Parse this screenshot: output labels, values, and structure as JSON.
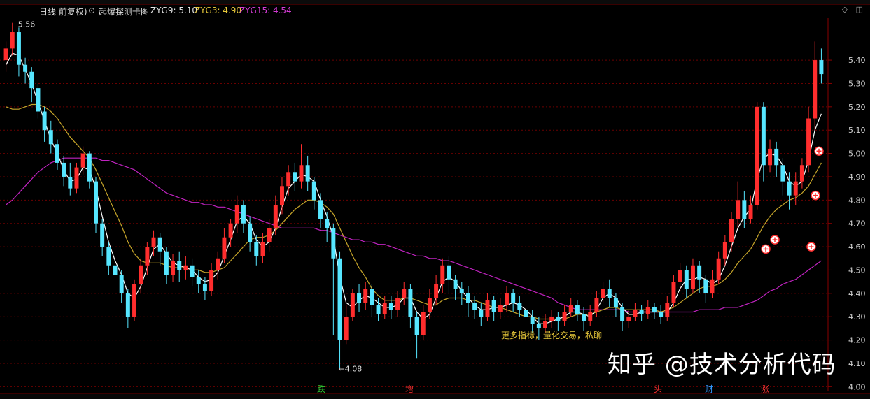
{
  "header": {
    "period": "日线 前复权)",
    "indicator_name": "起爆探测卡图",
    "zyg9_label": "ZYG9: 5.10",
    "zyg3_label": "ZYG3: 4.90",
    "zyg15_label": "ZYG15: 4.54"
  },
  "controls": {
    "diamond": "◇",
    "restore": "◫"
  },
  "colors": {
    "up": "#ff2d2d",
    "down": "#56e6ff",
    "zyg3": "#ffffff",
    "zyg9": "#c6a52a",
    "zyg15": "#c023c0",
    "grid": "#6b0000",
    "axis_text": "#d0d0d0"
  },
  "watermark": "知乎 @技术分析代码",
  "overlay_text": "更多指标，量化交易，私聊",
  "markers": [
    {
      "label": "跌",
      "color": "#33cc33"
    },
    {
      "label": "增",
      "color": "#ff3333"
    },
    {
      "label": "头",
      "color": "#ff3333"
    },
    {
      "label": "财",
      "color": "#3399ff"
    },
    {
      "label": "涨",
      "color": "#ff3333"
    }
  ],
  "chart_data": {
    "type": "candlestick",
    "y_ticks": [
      "5.40",
      "5.30",
      "5.20",
      "5.10",
      "5.00",
      "4.90",
      "4.80",
      "4.70",
      "4.60",
      "4.50",
      "4.40",
      "4.30",
      "4.20",
      "4.10",
      "4.00"
    ],
    "ylim": [
      3.98,
      5.58
    ],
    "high_label": "5.56",
    "low_label": "←4.08",
    "high_price": 5.56,
    "low_price": 4.08,
    "candles": [
      [
        5.4,
        5.45,
        5.35,
        5.48
      ],
      [
        5.45,
        5.52,
        5.42,
        5.56
      ],
      [
        5.52,
        5.38,
        5.33,
        5.54
      ],
      [
        5.38,
        5.35,
        5.3,
        5.41
      ],
      [
        5.35,
        5.28,
        5.22,
        5.37
      ],
      [
        5.28,
        5.18,
        5.15,
        5.3
      ],
      [
        5.18,
        5.1,
        5.05,
        5.2
      ],
      [
        5.1,
        5.04,
        5.0,
        5.14
      ],
      [
        5.04,
        4.96,
        4.93,
        5.06
      ],
      [
        4.96,
        4.9,
        4.86,
        4.99
      ],
      [
        4.9,
        4.85,
        4.82,
        4.96
      ],
      [
        4.85,
        4.94,
        4.83,
        4.96
      ],
      [
        4.94,
        5.0,
        4.91,
        5.03
      ],
      [
        5.0,
        4.88,
        4.85,
        5.01
      ],
      [
        4.88,
        4.7,
        4.66,
        4.9
      ],
      [
        4.7,
        4.6,
        4.56,
        4.72
      ],
      [
        4.6,
        4.52,
        4.48,
        4.62
      ],
      [
        4.52,
        4.48,
        4.44,
        4.55
      ],
      [
        4.48,
        4.4,
        4.36,
        4.5
      ],
      [
        4.4,
        4.3,
        4.25,
        4.42
      ],
      [
        4.3,
        4.44,
        4.28,
        4.46
      ],
      [
        4.44,
        4.52,
        4.4,
        4.55
      ],
      [
        4.52,
        4.6,
        4.48,
        4.62
      ],
      [
        4.6,
        4.64,
        4.56,
        4.67
      ],
      [
        4.64,
        4.58,
        4.52,
        4.66
      ],
      [
        4.58,
        4.48,
        4.44,
        4.6
      ],
      [
        4.48,
        4.54,
        4.45,
        4.57
      ],
      [
        4.54,
        4.5,
        4.45,
        4.58
      ],
      [
        4.5,
        4.52,
        4.46,
        4.56
      ],
      [
        4.52,
        4.47,
        4.43,
        4.55
      ],
      [
        4.47,
        4.44,
        4.4,
        4.5
      ],
      [
        4.44,
        4.41,
        4.37,
        4.47
      ],
      [
        4.41,
        4.5,
        4.39,
        4.53
      ],
      [
        4.5,
        4.55,
        4.46,
        4.58
      ],
      [
        4.55,
        4.64,
        4.53,
        4.68
      ],
      [
        4.64,
        4.7,
        4.6,
        4.72
      ],
      [
        4.7,
        4.78,
        4.66,
        4.82
      ],
      [
        4.78,
        4.7,
        4.66,
        4.8
      ],
      [
        4.7,
        4.62,
        4.58,
        4.73
      ],
      [
        4.62,
        4.56,
        4.52,
        4.65
      ],
      [
        4.56,
        4.62,
        4.53,
        4.66
      ],
      [
        4.62,
        4.68,
        4.58,
        4.72
      ],
      [
        4.68,
        4.78,
        4.65,
        4.82
      ],
      [
        4.78,
        4.86,
        4.74,
        4.9
      ],
      [
        4.86,
        4.92,
        4.82,
        4.95
      ],
      [
        4.92,
        4.88,
        4.84,
        4.96
      ],
      [
        4.88,
        4.95,
        4.85,
        5.04
      ],
      [
        4.95,
        4.88,
        4.84,
        4.99
      ],
      [
        4.88,
        4.8,
        4.76,
        4.9
      ],
      [
        4.8,
        4.72,
        4.68,
        4.83
      ],
      [
        4.72,
        4.68,
        4.62,
        4.75
      ],
      [
        4.68,
        4.55,
        4.22,
        4.7
      ],
      [
        4.55,
        4.2,
        4.08,
        4.58
      ],
      [
        4.2,
        4.3,
        4.18,
        4.35
      ],
      [
        4.3,
        4.4,
        4.28,
        4.42
      ],
      [
        4.4,
        4.36,
        4.32,
        4.44
      ],
      [
        4.36,
        4.42,
        4.33,
        4.45
      ],
      [
        4.42,
        4.35,
        4.3,
        4.44
      ],
      [
        4.35,
        4.31,
        4.28,
        4.38
      ],
      [
        4.31,
        4.36,
        4.29,
        4.39
      ],
      [
        4.36,
        4.33,
        4.29,
        4.39
      ],
      [
        4.33,
        4.38,
        4.3,
        4.41
      ],
      [
        4.38,
        4.42,
        4.35,
        4.45
      ],
      [
        4.42,
        4.3,
        4.25,
        4.44
      ],
      [
        4.3,
        4.22,
        4.12,
        4.32
      ],
      [
        4.22,
        4.32,
        4.2,
        4.35
      ],
      [
        4.32,
        4.38,
        4.29,
        4.42
      ],
      [
        4.38,
        4.44,
        4.35,
        4.48
      ],
      [
        4.44,
        4.52,
        4.4,
        4.55
      ],
      [
        4.52,
        4.46,
        4.4,
        4.56
      ],
      [
        4.46,
        4.42,
        4.37,
        4.48
      ],
      [
        4.42,
        4.4,
        4.35,
        4.45
      ],
      [
        4.4,
        4.36,
        4.3,
        4.43
      ],
      [
        4.36,
        4.33,
        4.29,
        4.39
      ],
      [
        4.33,
        4.3,
        4.26,
        4.36
      ],
      [
        4.3,
        4.37,
        4.28,
        4.4
      ],
      [
        4.37,
        4.32,
        4.28,
        4.39
      ],
      [
        4.32,
        4.35,
        4.29,
        4.38
      ],
      [
        4.35,
        4.4,
        4.32,
        4.43
      ],
      [
        4.4,
        4.36,
        4.32,
        4.42
      ],
      [
        4.36,
        4.33,
        4.3,
        4.39
      ],
      [
        4.33,
        4.3,
        4.26,
        4.36
      ],
      [
        4.3,
        4.27,
        4.23,
        4.33
      ],
      [
        4.27,
        4.25,
        4.2,
        4.3
      ],
      [
        4.25,
        4.28,
        4.23,
        4.31
      ],
      [
        4.28,
        4.3,
        4.25,
        4.33
      ],
      [
        4.3,
        4.28,
        4.24,
        4.32
      ],
      [
        4.28,
        4.32,
        4.26,
        4.35
      ],
      [
        4.32,
        4.35,
        4.3,
        4.38
      ],
      [
        4.35,
        4.31,
        4.28,
        4.37
      ],
      [
        4.31,
        4.28,
        4.24,
        4.34
      ],
      [
        4.28,
        4.32,
        4.26,
        4.35
      ],
      [
        4.32,
        4.38,
        4.3,
        4.41
      ],
      [
        4.38,
        4.42,
        4.36,
        4.45
      ],
      [
        4.42,
        4.38,
        4.34,
        4.46
      ],
      [
        4.38,
        4.34,
        4.3,
        4.4
      ],
      [
        4.34,
        4.28,
        4.24,
        4.36
      ],
      [
        4.28,
        4.3,
        4.25,
        4.33
      ],
      [
        4.3,
        4.33,
        4.28,
        4.36
      ],
      [
        4.33,
        4.31,
        4.28,
        4.35
      ],
      [
        4.31,
        4.34,
        4.29,
        4.37
      ],
      [
        4.34,
        4.32,
        4.29,
        4.36
      ],
      [
        4.32,
        4.3,
        4.27,
        4.35
      ],
      [
        4.3,
        4.36,
        4.28,
        4.39
      ],
      [
        4.36,
        4.45,
        4.34,
        4.48
      ],
      [
        4.45,
        4.5,
        4.41,
        4.53
      ],
      [
        4.5,
        4.42,
        4.38,
        4.52
      ],
      [
        4.42,
        4.52,
        4.4,
        4.55
      ],
      [
        4.52,
        4.46,
        4.4,
        4.54
      ],
      [
        4.46,
        4.4,
        4.36,
        4.48
      ],
      [
        4.4,
        4.46,
        4.38,
        4.5
      ],
      [
        4.46,
        4.55,
        4.44,
        4.58
      ],
      [
        4.55,
        4.62,
        4.52,
        4.65
      ],
      [
        4.62,
        4.72,
        4.58,
        4.75
      ],
      [
        4.72,
        4.8,
        4.68,
        4.88
      ],
      [
        4.8,
        4.72,
        4.68,
        4.84
      ],
      [
        4.72,
        4.78,
        4.7,
        4.82
      ],
      [
        4.78,
        5.2,
        4.76,
        5.22
      ],
      [
        5.2,
        4.95,
        4.88,
        5.22
      ],
      [
        4.95,
        5.02,
        4.92,
        5.06
      ],
      [
        5.02,
        4.95,
        4.9,
        5.05
      ],
      [
        4.95,
        4.88,
        4.82,
        4.98
      ],
      [
        4.88,
        4.82,
        4.76,
        4.92
      ],
      [
        4.82,
        4.88,
        4.78,
        4.92
      ],
      [
        4.88,
        4.95,
        4.85,
        4.98
      ],
      [
        4.95,
        5.15,
        4.92,
        5.2
      ],
      [
        5.15,
        5.4,
        5.1,
        5.48
      ],
      [
        5.4,
        5.34,
        5.3,
        5.45
      ]
    ],
    "zyg3": [
      5.38,
      5.43,
      5.42,
      5.36,
      5.3,
      5.22,
      5.14,
      5.06,
      5.0,
      4.93,
      4.88,
      4.89,
      4.94,
      4.93,
      4.85,
      4.73,
      4.62,
      4.54,
      4.48,
      4.4,
      4.38,
      4.43,
      4.51,
      4.59,
      4.61,
      4.57,
      4.53,
      4.52,
      4.51,
      4.5,
      4.47,
      4.45,
      4.46,
      4.49,
      4.56,
      4.63,
      4.71,
      4.73,
      4.7,
      4.63,
      4.6,
      4.62,
      4.68,
      4.77,
      4.85,
      4.88,
      4.91,
      4.9,
      4.88,
      4.8,
      4.73,
      4.64,
      4.47,
      4.36,
      4.34,
      4.37,
      4.39,
      4.38,
      4.36,
      4.34,
      4.34,
      4.35,
      4.38,
      4.38,
      4.32,
      4.29,
      4.31,
      4.38,
      4.45,
      4.47,
      4.45,
      4.41,
      4.38,
      4.35,
      4.33,
      4.33,
      4.34,
      4.34,
      4.35,
      4.36,
      4.35,
      4.33,
      4.3,
      4.27,
      4.27,
      4.28,
      4.29,
      4.3,
      4.32,
      4.32,
      4.31,
      4.3,
      4.33,
      4.38,
      4.4,
      4.38,
      4.34,
      4.31,
      4.31,
      4.32,
      4.32,
      4.32,
      4.32,
      4.32,
      4.36,
      4.42,
      4.46,
      4.46,
      4.47,
      4.46,
      4.44,
      4.46,
      4.52,
      4.6,
      4.68,
      4.73,
      4.76,
      4.89,
      4.98,
      5.0,
      4.99,
      4.95,
      4.88,
      4.86,
      4.88,
      4.97,
      5.1,
      5.17
    ],
    "zyg9": [
      5.2,
      5.19,
      5.19,
      5.2,
      5.21,
      5.21,
      5.2,
      5.18,
      5.15,
      5.11,
      5.07,
      5.04,
      5.01,
      4.98,
      4.93,
      4.87,
      4.81,
      4.75,
      4.69,
      4.62,
      4.57,
      4.54,
      4.53,
      4.53,
      4.53,
      4.52,
      4.51,
      4.51,
      4.51,
      4.5,
      4.5,
      4.49,
      4.49,
      4.5,
      4.51,
      4.54,
      4.57,
      4.6,
      4.63,
      4.64,
      4.64,
      4.65,
      4.67,
      4.7,
      4.73,
      4.76,
      4.78,
      4.8,
      4.8,
      4.79,
      4.77,
      4.74,
      4.68,
      4.62,
      4.56,
      4.51,
      4.47,
      4.42,
      4.39,
      4.37,
      4.37,
      4.37,
      4.38,
      4.38,
      4.37,
      4.36,
      4.35,
      4.35,
      4.37,
      4.38,
      4.38,
      4.38,
      4.37,
      4.37,
      4.36,
      4.35,
      4.34,
      4.34,
      4.33,
      4.32,
      4.31,
      4.3,
      4.3,
      4.29,
      4.29,
      4.29,
      4.29,
      4.29,
      4.3,
      4.31,
      4.31,
      4.31,
      4.32,
      4.33,
      4.34,
      4.34,
      4.33,
      4.33,
      4.33,
      4.33,
      4.33,
      4.33,
      4.32,
      4.33,
      4.34,
      4.36,
      4.38,
      4.4,
      4.42,
      4.43,
      4.43,
      4.44,
      4.46,
      4.49,
      4.53,
      4.56,
      4.59,
      4.64,
      4.69,
      4.73,
      4.76,
      4.78,
      4.8,
      4.81,
      4.83,
      4.86,
      4.91,
      4.96
    ],
    "zyg15": [
      4.78,
      4.8,
      4.83,
      4.86,
      4.89,
      4.92,
      4.94,
      4.96,
      4.97,
      4.98,
      4.98,
      4.98,
      4.98,
      4.98,
      4.98,
      4.97,
      4.97,
      4.96,
      4.95,
      4.94,
      4.93,
      4.91,
      4.89,
      4.87,
      4.85,
      4.83,
      4.82,
      4.81,
      4.8,
      4.79,
      4.79,
      4.78,
      4.78,
      4.77,
      4.77,
      4.76,
      4.75,
      4.74,
      4.73,
      4.72,
      4.71,
      4.7,
      4.69,
      4.68,
      4.68,
      4.68,
      4.68,
      4.68,
      4.68,
      4.67,
      4.67,
      4.66,
      4.65,
      4.64,
      4.63,
      4.63,
      4.62,
      4.62,
      4.61,
      4.61,
      4.6,
      4.59,
      4.58,
      4.57,
      4.56,
      4.56,
      4.55,
      4.55,
      4.54,
      4.54,
      4.53,
      4.52,
      4.51,
      4.5,
      4.49,
      4.48,
      4.47,
      4.46,
      4.45,
      4.44,
      4.43,
      4.42,
      4.41,
      4.4,
      4.39,
      4.38,
      4.36,
      4.35,
      4.34,
      4.33,
      4.33,
      4.33,
      4.33,
      4.33,
      4.33,
      4.33,
      4.33,
      4.32,
      4.32,
      4.32,
      4.32,
      4.32,
      4.32,
      4.32,
      4.32,
      4.32,
      4.32,
      4.32,
      4.33,
      4.33,
      4.33,
      4.33,
      4.34,
      4.34,
      4.34,
      4.35,
      4.36,
      4.37,
      4.39,
      4.41,
      4.42,
      4.44,
      4.45,
      4.46,
      4.48,
      4.5,
      4.52,
      4.54
    ],
    "signal_markers": [
      {
        "x": 1094,
        "y": 4.59
      },
      {
        "x": 1107,
        "y": 4.63
      },
      {
        "x": 1170,
        "y": 5.01
      },
      {
        "x": 1165,
        "y": 4.82
      },
      {
        "x": 1159,
        "y": 4.6
      }
    ]
  }
}
